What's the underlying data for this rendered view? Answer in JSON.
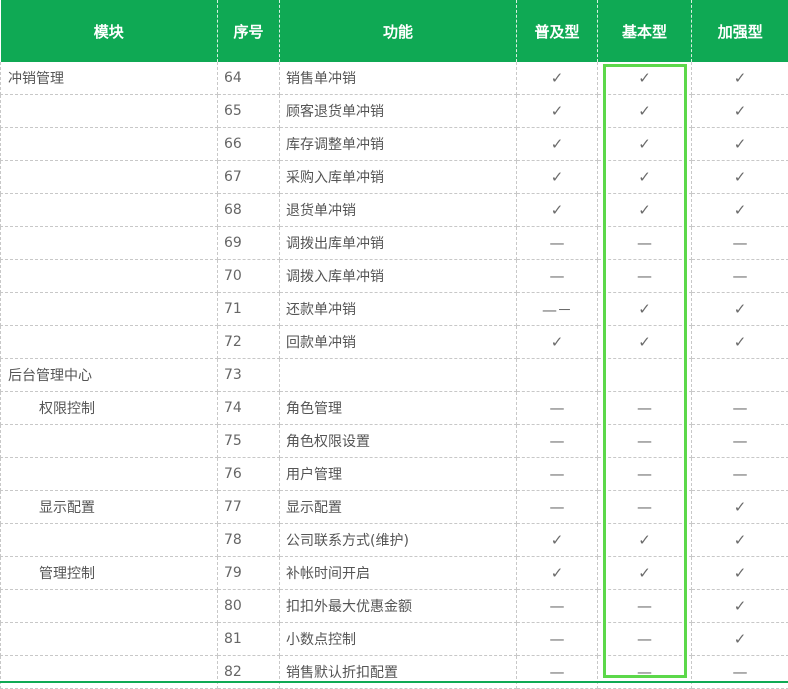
{
  "header": {
    "module": "模块",
    "num": "序号",
    "func": "功能",
    "basic_pop": "普及型",
    "basic": "基本型",
    "enhanced": "加强型"
  },
  "marks": {
    "check": "✓",
    "dash": "—"
  },
  "highlight": {
    "column": "基本型",
    "color": "#5cd84a"
  },
  "colors": {
    "header_bg": "#0fa954",
    "header_text": "#ffffff",
    "grid": "#c8c8c8"
  },
  "rows": [
    {
      "module": "冲销管理",
      "indent": false,
      "num": "64",
      "func": "销售单冲销",
      "pop": "✓",
      "basic": "✓",
      "enh": "✓"
    },
    {
      "module": "",
      "indent": false,
      "num": "65",
      "func": "顾客退货单冲销",
      "pop": "✓",
      "basic": "✓",
      "enh": "✓"
    },
    {
      "module": "",
      "indent": false,
      "num": "66",
      "func": "库存调整单冲销",
      "pop": "✓",
      "basic": "✓",
      "enh": "✓"
    },
    {
      "module": "",
      "indent": false,
      "num": "67",
      "func": "采购入库单冲销",
      "pop": "✓",
      "basic": "✓",
      "enh": "✓"
    },
    {
      "module": "",
      "indent": false,
      "num": "68",
      "func": "退货单冲销",
      "pop": "✓",
      "basic": "✓",
      "enh": "✓"
    },
    {
      "module": "",
      "indent": false,
      "num": "69",
      "func": "调拨出库单冲销",
      "pop": "—",
      "basic": "—",
      "enh": "—"
    },
    {
      "module": "",
      "indent": false,
      "num": "70",
      "func": "调拨入库单冲销",
      "pop": "—",
      "basic": "—",
      "enh": "—"
    },
    {
      "module": "",
      "indent": false,
      "num": "71",
      "func": "还款单冲销",
      "pop": "—－",
      "basic": "✓",
      "enh": "✓"
    },
    {
      "module": "",
      "indent": false,
      "num": "72",
      "func": "回款单冲销",
      "pop": "✓",
      "basic": "✓",
      "enh": "✓"
    },
    {
      "module": "后台管理中心",
      "indent": false,
      "num": "73",
      "func": "",
      "pop": "",
      "basic": "",
      "enh": ""
    },
    {
      "module": "权限控制",
      "indent": true,
      "num": "74",
      "func": "角色管理",
      "pop": "—",
      "basic": "—",
      "enh": "—"
    },
    {
      "module": "",
      "indent": false,
      "num": "75",
      "func": "角色权限设置",
      "pop": "—",
      "basic": "—",
      "enh": "—"
    },
    {
      "module": "",
      "indent": false,
      "num": "76",
      "func": "用户管理",
      "pop": "—",
      "basic": "—",
      "enh": "—"
    },
    {
      "module": "显示配置",
      "indent": true,
      "num": "77",
      "func": "显示配置",
      "pop": "—",
      "basic": "—",
      "enh": "✓"
    },
    {
      "module": "",
      "indent": false,
      "num": "78",
      "func": "公司联系方式(维护)",
      "pop": "✓",
      "basic": "✓",
      "enh": "✓"
    },
    {
      "module": "管理控制",
      "indent": true,
      "num": "79",
      "func": "补帐时间开启",
      "pop": "✓",
      "basic": "✓",
      "enh": "✓"
    },
    {
      "module": "",
      "indent": false,
      "num": "80",
      "func": "扣扣外最大优惠金额",
      "pop": "—",
      "basic": "—",
      "enh": "✓"
    },
    {
      "module": "",
      "indent": false,
      "num": "81",
      "func": "小数点控制",
      "pop": "—",
      "basic": "—",
      "enh": "✓"
    },
    {
      "module": "",
      "indent": false,
      "num": "82",
      "func": "销售默认折扣配置",
      "pop": "—",
      "basic": "—",
      "enh": "—"
    }
  ]
}
